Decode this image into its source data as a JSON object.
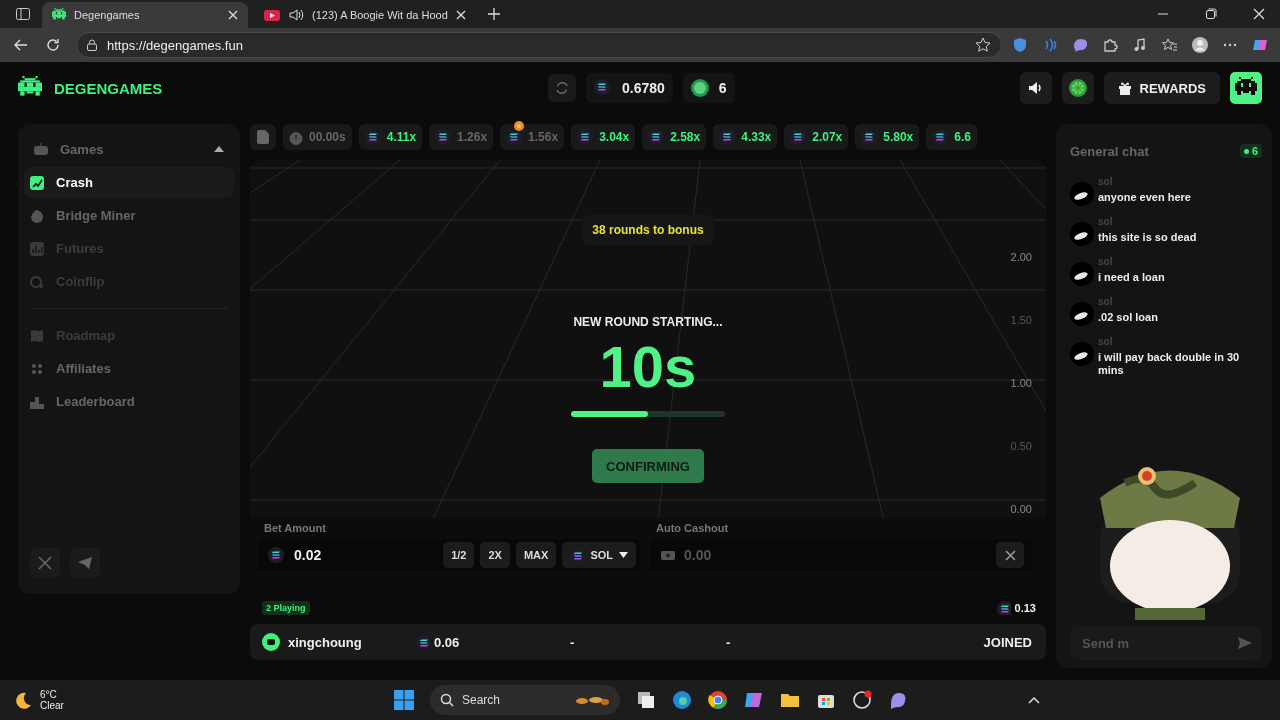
{
  "browser": {
    "tabs": [
      {
        "title": "Degengames",
        "selected": true,
        "audio": false
      },
      {
        "title": "(123) A Boogie Wit da Hood",
        "selected": false,
        "audio": true
      }
    ],
    "url": "https://degengames.fun"
  },
  "header": {
    "logo": "DEGENGAMES",
    "balance": "0.6780",
    "tokens": "6",
    "rewards": "REWARDS"
  },
  "sidebar": {
    "group": {
      "title": "Games",
      "expanded": true
    },
    "games": [
      {
        "label": "Crash",
        "selected": true,
        "disabled": false
      },
      {
        "label": "Bridge Miner",
        "selected": false,
        "disabled": false
      },
      {
        "label": "Futures",
        "selected": false,
        "disabled": true
      },
      {
        "label": "Coinflip",
        "selected": false,
        "disabled": true
      }
    ],
    "links": [
      {
        "label": "Roadmap",
        "disabled": true
      },
      {
        "label": "Affiliates",
        "disabled": false
      },
      {
        "label": "Leaderboard",
        "disabled": false
      }
    ]
  },
  "ticker": {
    "timer": "00.00s",
    "multipliers": [
      {
        "value": "4.11x",
        "high": true,
        "boosted": false
      },
      {
        "value": "1.26x",
        "high": false,
        "boosted": false
      },
      {
        "value": "1.56x",
        "high": false,
        "boosted": true
      },
      {
        "value": "3.04x",
        "high": true,
        "boosted": false
      },
      {
        "value": "2.58x",
        "high": true,
        "boosted": false
      },
      {
        "value": "4.33x",
        "high": true,
        "boosted": false
      },
      {
        "value": "2.07x",
        "high": true,
        "boosted": false
      },
      {
        "value": "5.80x",
        "high": true,
        "boosted": false
      },
      {
        "value": "6.6",
        "high": true,
        "boosted": false
      }
    ]
  },
  "game": {
    "bonus": "38 rounds to bonus",
    "status": "NEW ROUND STARTING...",
    "countdown": "10s",
    "level": 0.5,
    "button": "CONFIRMING",
    "y_labels": [
      {
        "text": "2.00",
        "faded": false
      },
      {
        "text": "1.50",
        "faded": true
      },
      {
        "text": "1.00",
        "faded": false
      },
      {
        "text": "0.50",
        "faded": true
      },
      {
        "text": "0.00",
        "faded": false
      }
    ]
  },
  "bet": {
    "label": "Bet Amount",
    "value": "0.02",
    "buttons": [
      "1/2",
      "2X",
      "MAX"
    ],
    "currency": "SOL"
  },
  "cashout": {
    "label": "Auto Cashout",
    "placeholder": "0.00"
  },
  "players": {
    "count": "2 Playing",
    "total": "0.13",
    "rows": [
      {
        "name": "xingchoung",
        "bet": "0.06",
        "column_3": "-",
        "column_4": "-",
        "status": "JOINED"
      }
    ]
  },
  "chat": {
    "title": "General chat",
    "online": "6",
    "placeholder": "Send m",
    "messages": [
      {
        "user": "sol",
        "text": "anyone even here"
      },
      {
        "user": "sol",
        "text": "this site is so dead"
      },
      {
        "user": "sol",
        "text": "i need a loan"
      },
      {
        "user": "sol",
        "text": ".02 sol loan"
      },
      {
        "user": "sol",
        "text": "i will pay back double in 30 mins"
      }
    ]
  },
  "taskbar": {
    "temperature": "6°C",
    "weather": "Clear",
    "search": "Search"
  }
}
